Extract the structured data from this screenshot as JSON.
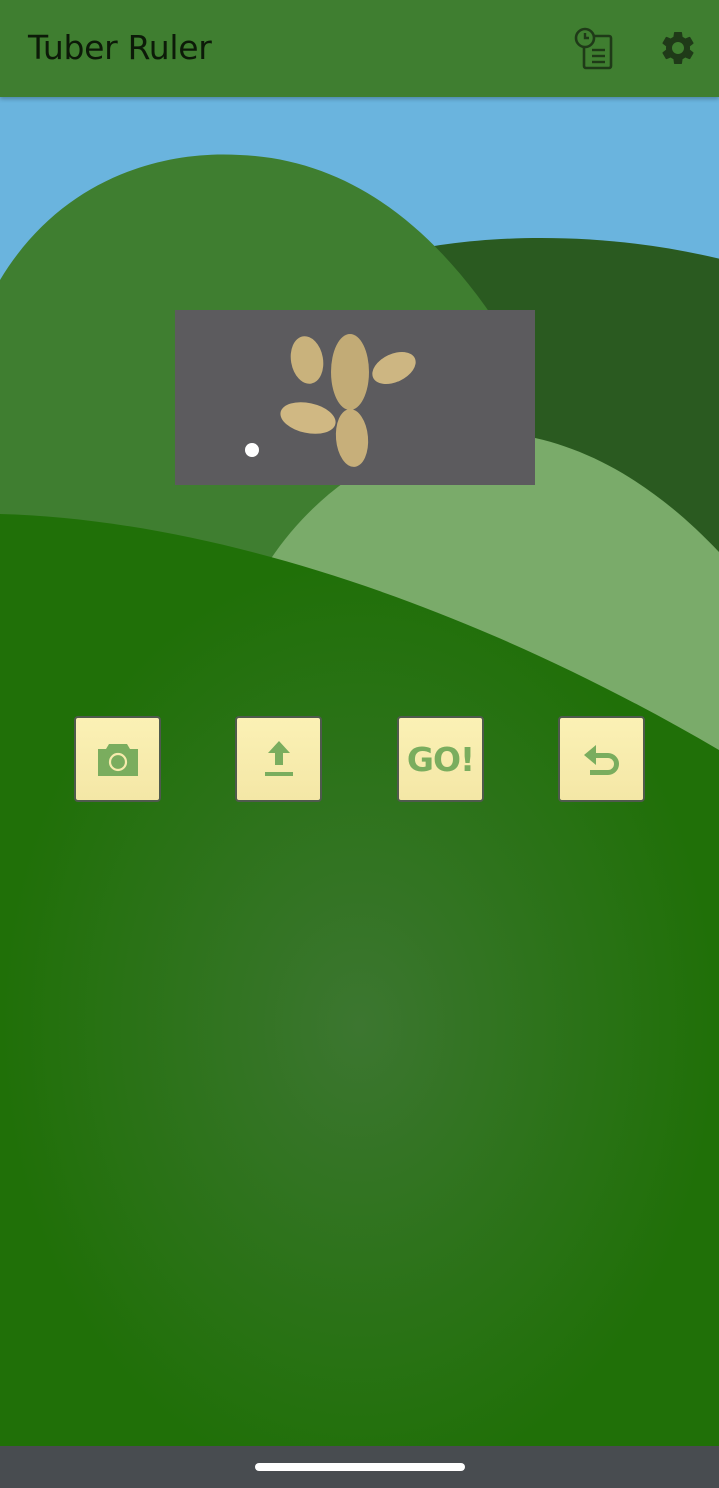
{
  "app": {
    "title": "Tuber Ruler"
  },
  "toolbar": {
    "history_icon": "history-clipboard-icon",
    "settings_icon": "gear-icon"
  },
  "actions": [
    {
      "name": "camera",
      "icon": "camera-icon"
    },
    {
      "name": "upload",
      "icon": "upload-icon"
    },
    {
      "name": "go",
      "label": "GO!"
    },
    {
      "name": "undo",
      "icon": "undo-icon"
    }
  ],
  "colors": {
    "appbar": "#3f7e30",
    "sky": "#6ab4de",
    "button_face": "#fbf1b5",
    "button_icon": "#7aad5e",
    "navbar": "#484c50"
  }
}
